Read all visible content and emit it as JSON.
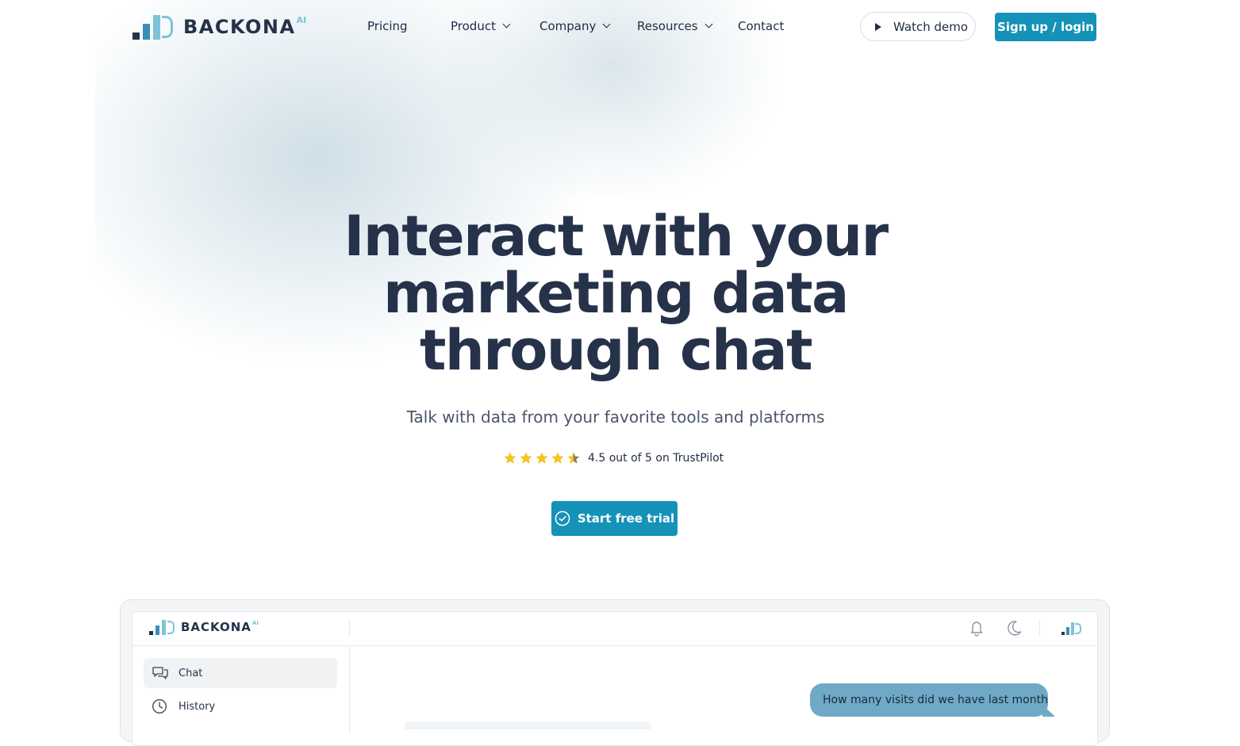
{
  "brand": {
    "name": "BACKONA",
    "suffix": "AI"
  },
  "colors": {
    "accent": "#1492b8",
    "dark_text": "#26324a",
    "logo_light": "#7ec3d8",
    "logo_mid": "#3a8fb8",
    "star": "#f5c518",
    "bubble": "#6fa9c6"
  },
  "nav": {
    "items": [
      {
        "label": "Pricing",
        "dropdown": false
      },
      {
        "label": "Product",
        "dropdown": true
      },
      {
        "label": "Company",
        "dropdown": true
      },
      {
        "label": "Resources",
        "dropdown": true
      },
      {
        "label": "Contact",
        "dropdown": false
      }
    ],
    "watch_demo": "Watch demo",
    "signup": "Sign up / login"
  },
  "hero": {
    "title_lines": [
      "Interact with your",
      "marketing data",
      "through chat"
    ],
    "subtitle": "Talk with data from your favorite tools and platforms",
    "rating": {
      "value": 4.5,
      "max": 5,
      "text": "4.5 out of 5 on TrustPilot"
    },
    "cta": "Start free trial"
  },
  "app_preview": {
    "brand": "BACKONA",
    "brand_suffix": "AI",
    "sidebar": [
      {
        "label": "Chat",
        "icon": "chat-bubbles-icon",
        "active": true
      },
      {
        "label": "History",
        "icon": "clock-icon",
        "active": false
      }
    ],
    "topbar_icons": [
      "bell-icon",
      "moon-icon",
      "logo-icon"
    ],
    "message": "How many visits did we have last month"
  }
}
